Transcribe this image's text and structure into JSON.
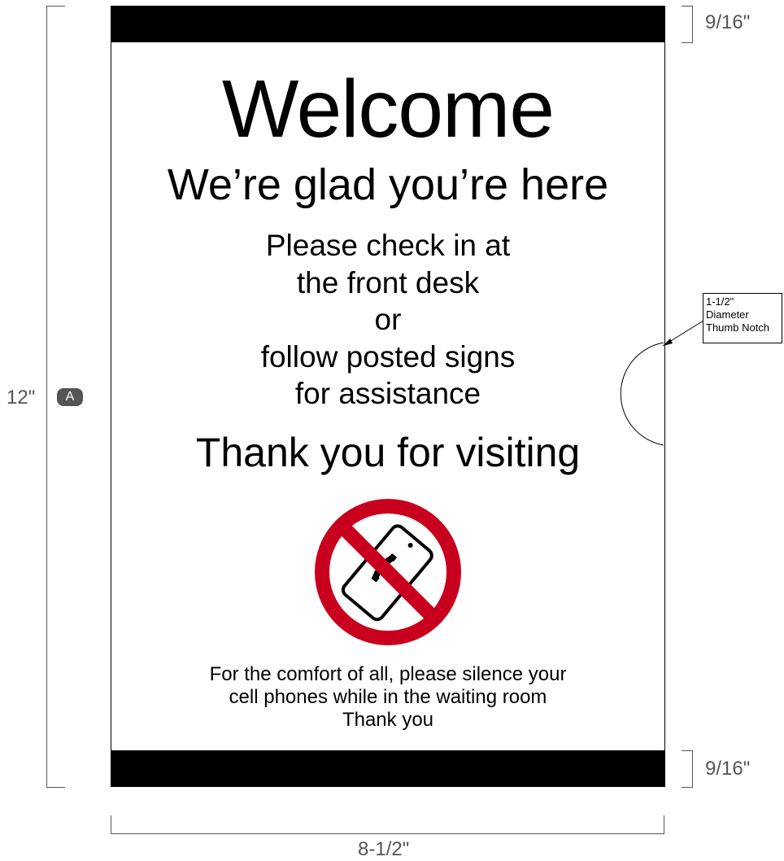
{
  "dimensions": {
    "height": "12\"",
    "height_badge": "A",
    "top_band": "9/16\"",
    "bottom_band": "9/16\"",
    "width": "8-1/2\""
  },
  "sign": {
    "heading": "Welcome",
    "subheading": "We’re glad you’re here",
    "instructions": [
      "Please check in at",
      "the front desk",
      "or",
      "follow posted signs",
      "for assistance"
    ],
    "thanks": "Thank you for visiting",
    "icon": "no-cell-phone-icon",
    "footer_lines": [
      "For the comfort of all, please silence your",
      "cell phones while in the waiting room",
      "Thank you"
    ],
    "colors": {
      "band": "#000000",
      "prohibition_red": "#c8001e"
    }
  },
  "callout": {
    "lines": [
      "1-1/2\"",
      "Diameter",
      "Thumb Notch"
    ]
  }
}
